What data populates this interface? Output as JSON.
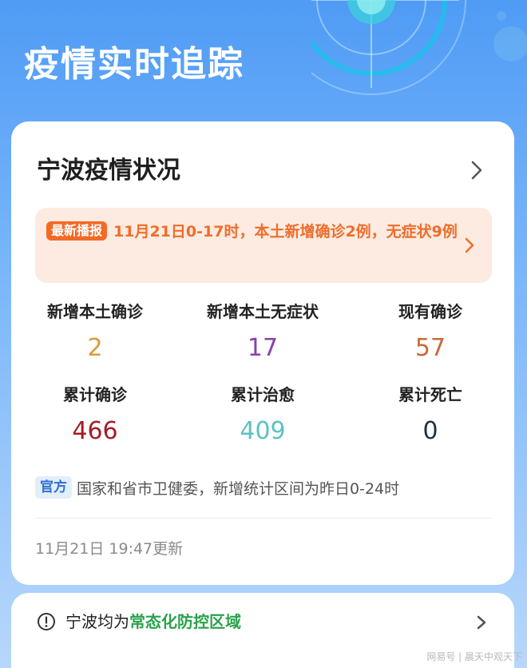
{
  "page": {
    "title": "疫情实时追踪"
  },
  "card": {
    "title": "宁波疫情状况",
    "news": {
      "badge": "最新播报",
      "text": "11月21日0-17时，本土新增确诊2例，无症状9例"
    },
    "stats": [
      {
        "label": "新增本土确诊",
        "value": "2",
        "color": "#d99a3a"
      },
      {
        "label": "新增本土无症状",
        "value": "17",
        "color": "#8a3fb0"
      },
      {
        "label": "现有确诊",
        "value": "57",
        "color": "#c9693c"
      },
      {
        "label": "累计确诊",
        "value": "466",
        "color": "#a31d24"
      },
      {
        "label": "累计治愈",
        "value": "409",
        "color": "#5cc2c3"
      },
      {
        "label": "累计死亡",
        "value": "0",
        "color": "#1f3140"
      }
    ],
    "source": {
      "badge": "官方",
      "text": "国家和省市卫健委，新增统计区间为昨日0-24时"
    },
    "update_time": "11月21日 19:47更新"
  },
  "bottom_bar": {
    "prefix": "宁波均为",
    "highlight": "常态化防控区域",
    "highlight_color": "#2aa24b"
  },
  "watermark": "网易号 | 晨天中观天下",
  "icons": {
    "card_chevron": "chevron-right-icon",
    "news_chevron": "chevron-right-icon",
    "alert": "exclamation-circle-icon",
    "bar_chevron": "chevron-right-icon"
  }
}
